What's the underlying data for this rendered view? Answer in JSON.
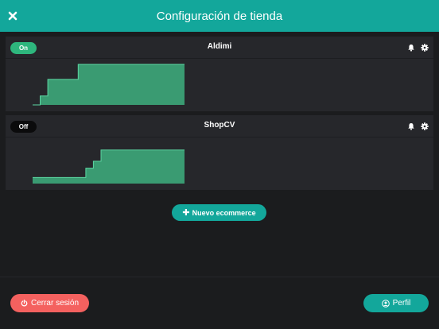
{
  "header": {
    "title": "Configuración de tienda",
    "close_icon": "close-icon"
  },
  "stores": [
    {
      "name": "Aldimi",
      "toggle_label": "On",
      "enabled": true,
      "activity_levels": [
        0.0,
        0.22,
        0.63,
        0.63,
        0.63,
        0.63,
        1.0,
        1.0,
        1.0,
        1.0,
        1.0,
        1.0,
        1.0,
        1.0,
        1.0,
        1.0,
        1.0,
        1.0,
        1.0,
        1.0
      ]
    },
    {
      "name": "ShopCV",
      "toggle_label": "Off",
      "enabled": false,
      "activity_levels": [
        0.15,
        0.15,
        0.15,
        0.15,
        0.15,
        0.15,
        0.15,
        0.38,
        0.55,
        0.83,
        0.83,
        0.83,
        0.83,
        0.83,
        0.83,
        0.83,
        0.83,
        0.83,
        0.83,
        0.83
      ]
    }
  ],
  "icons": {
    "bell": "bell-icon",
    "gear": "gear-icon"
  },
  "actions": {
    "add_ecommerce": "Nuevo ecommerce",
    "logout": "Cerrar sesión",
    "profile": "Perfil"
  },
  "colors": {
    "accent": "#13a79b",
    "toggle_on": "#2eb67d",
    "danger": "#f4615f",
    "chart_fill": "#3a9b72",
    "chart_line": "#5cd7a3"
  }
}
